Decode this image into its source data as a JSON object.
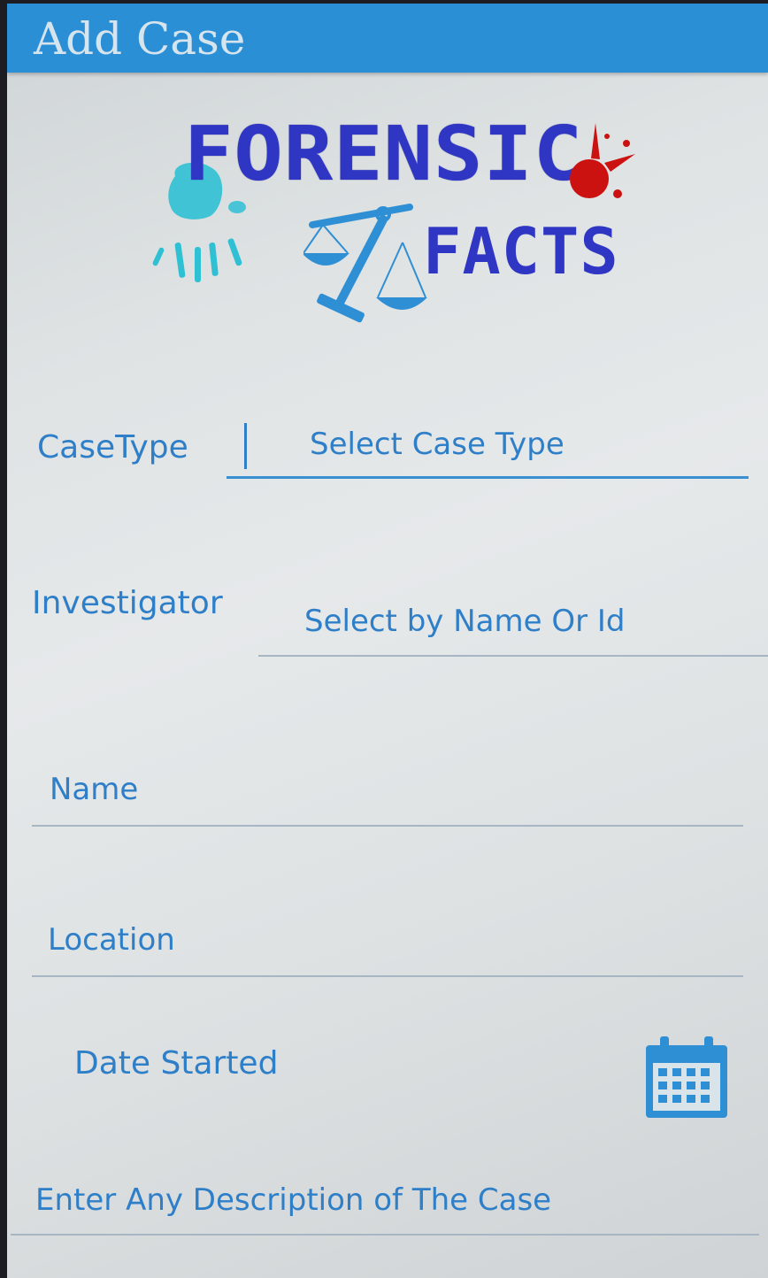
{
  "app_bar": {
    "title": "Add Case"
  },
  "logo": {
    "word1": "FORENSIC",
    "word2": "FACTS"
  },
  "form": {
    "case_type": {
      "label": "CaseType",
      "value": "Select Case Type"
    },
    "investigator": {
      "label": "Investigator",
      "placeholder": "Select  by Name Or Id"
    },
    "name": {
      "placeholder": "Name"
    },
    "location": {
      "placeholder": "Location"
    },
    "date_started": {
      "label": "Date Started",
      "icon": "calendar-icon"
    },
    "description": {
      "placeholder": "Enter Any Description of The Case"
    }
  },
  "colors": {
    "app_bar": "#2b8fd6",
    "text_accent": "#2f7fc8",
    "logo_blue": "#2f36c4",
    "logo_red": "#cc1111"
  }
}
